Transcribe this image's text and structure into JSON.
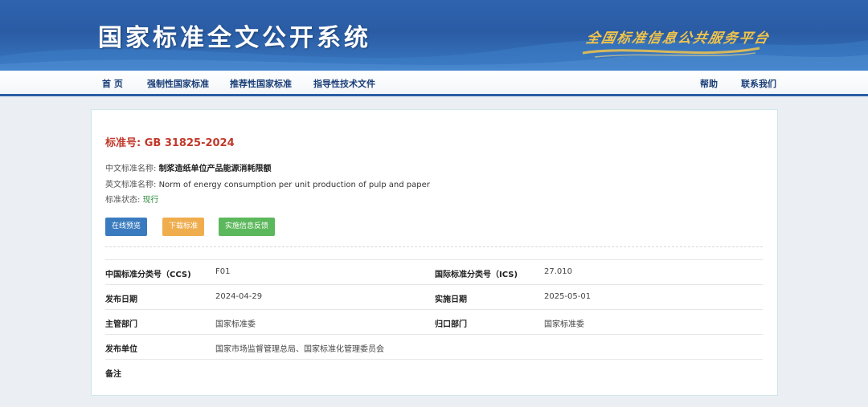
{
  "header": {
    "site_title": "国家标准全文公开系统",
    "slogan": "全国标准信息公共服务平台"
  },
  "nav": {
    "home": "首 页",
    "mandatory": "强制性国家标准",
    "recommended": "推荐性国家标准",
    "guiding": "指导性技术文件",
    "help": "帮助",
    "contact": "联系我们"
  },
  "standard": {
    "number_label": "标准号:",
    "number": "GB 31825-2024",
    "cn_name_label": "中文标准名称:",
    "cn_name": "制浆造纸单位产品能源消耗限额",
    "en_name_label": "英文标准名称:",
    "en_name": "Norm of energy consumption per unit production of pulp and paper",
    "status_label": "标准状态:",
    "status": "现行"
  },
  "buttons": {
    "preview": "在线预览",
    "download": "下载标准",
    "feedback": "实施信息反馈"
  },
  "details": {
    "ccs_label": "中国标准分类号（CCS)",
    "ccs": "F01",
    "ics_label": "国际标准分类号（ICS)",
    "ics": "27.010",
    "publish_label": "发布日期",
    "publish": "2024-04-29",
    "effective_label": "实施日期",
    "effective": "2025-05-01",
    "authority_label": "主管部门",
    "authority": "国家标准委",
    "centralized_label": "归口部门",
    "centralized": "国家标准委",
    "issuer_label": "发布单位",
    "issuer": "国家市场监督管理总局、国家标准化管理委员会",
    "remarks_label": "备注",
    "remarks": ""
  },
  "colors": {
    "banner_blue": "#2a5ca4",
    "nav_text": "#1a3e78",
    "std_red": "#c0392b",
    "status_green": "#2e8b3e",
    "btn_blue": "#3a7bbf",
    "btn_orange": "#f0ad4e",
    "btn_green": "#5cb85c",
    "slogan_gold": "#f2c44a"
  }
}
